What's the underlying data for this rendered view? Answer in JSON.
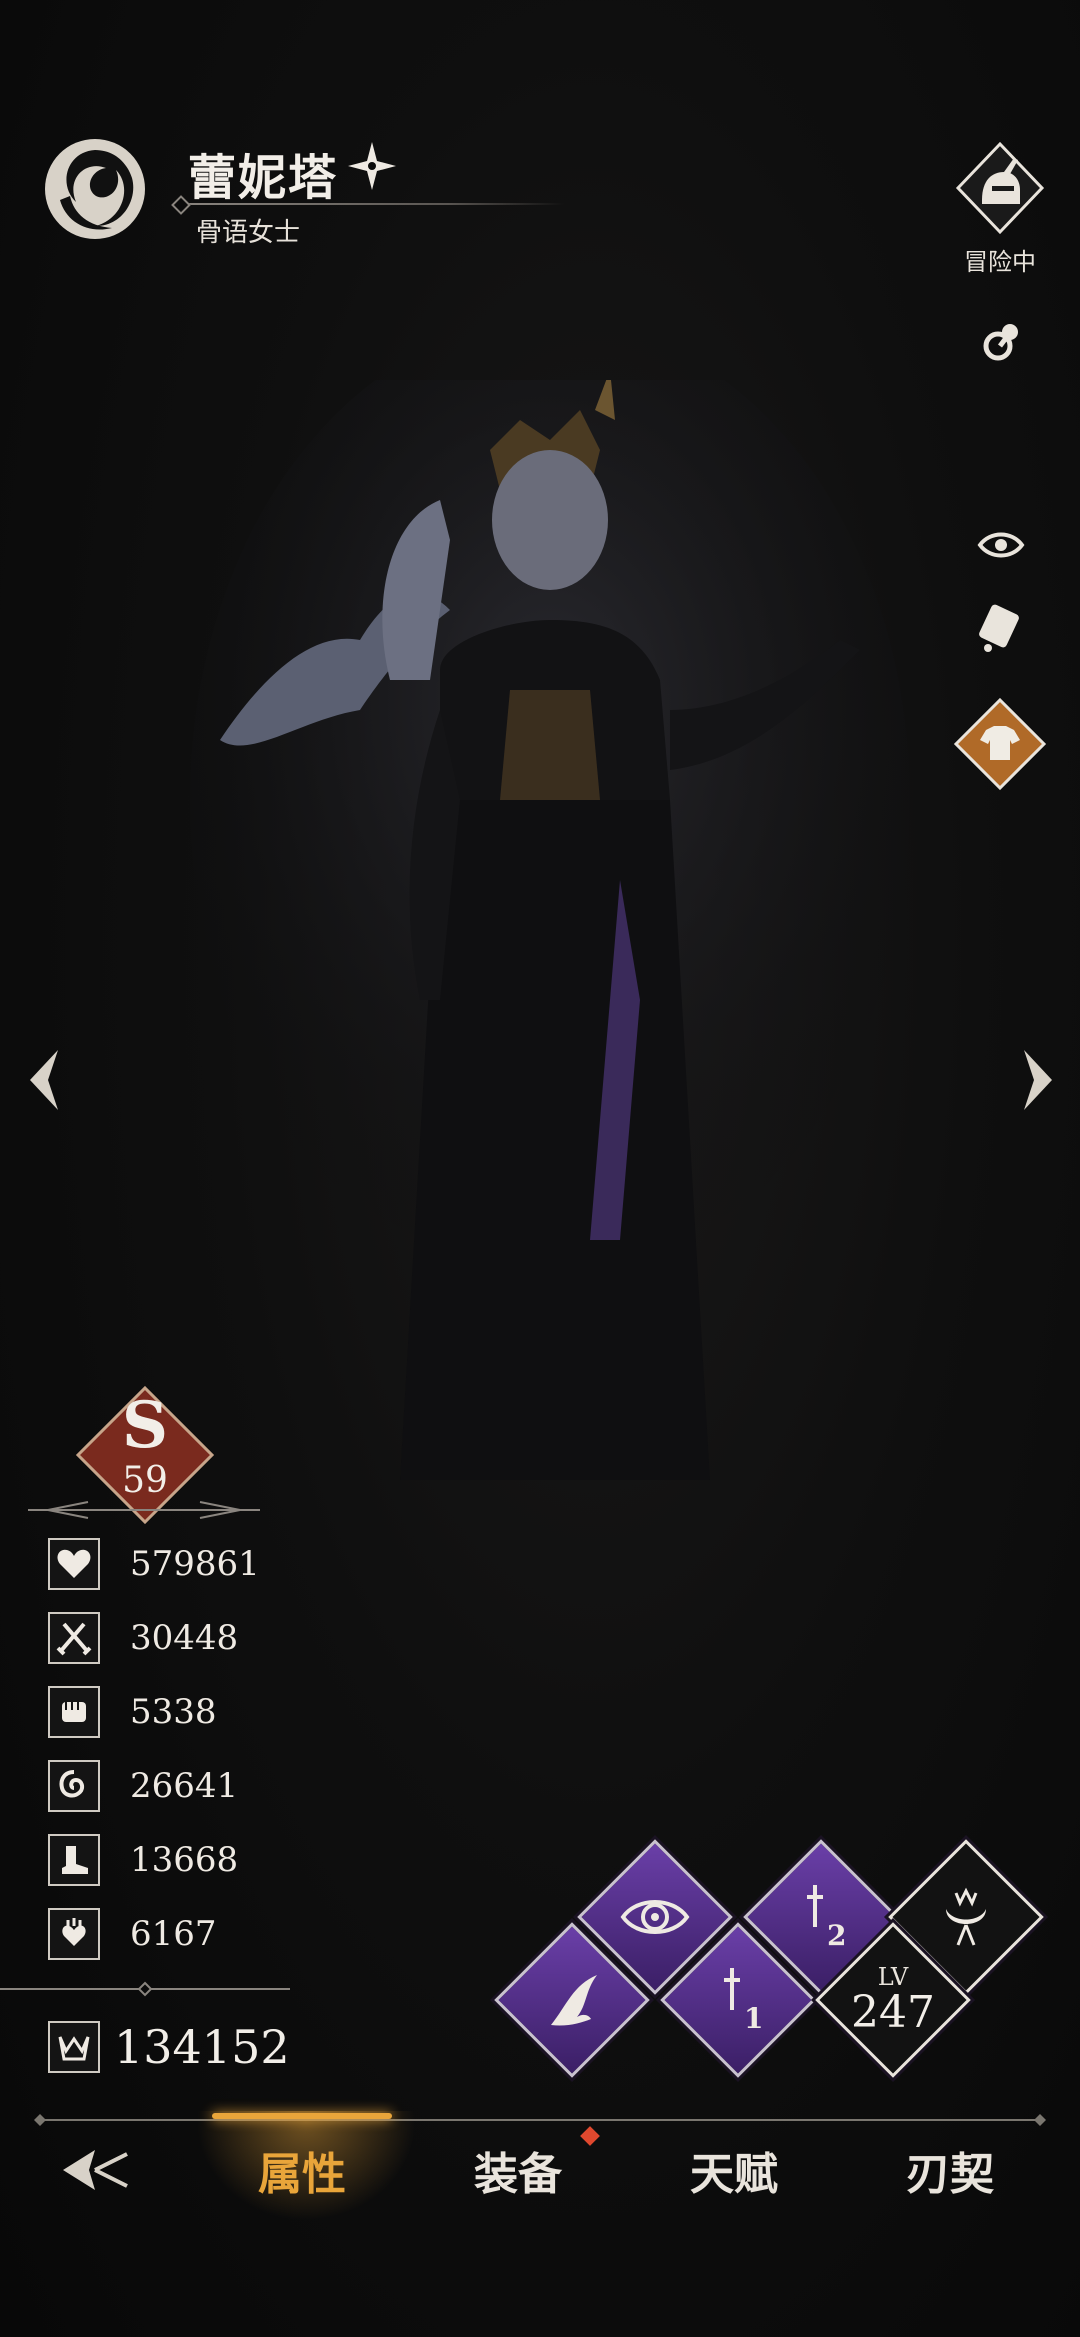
{
  "character": {
    "name": "蕾妮塔",
    "subtitle": "骨语女士"
  },
  "right_panel": {
    "adventure_label": "冒险中"
  },
  "rank": {
    "letter": "S",
    "value": "59"
  },
  "stats": [
    {
      "icon": "heart-icon",
      "value": "579861"
    },
    {
      "icon": "crossed-swords-icon",
      "value": "30448"
    },
    {
      "icon": "fist-icon",
      "value": "5338"
    },
    {
      "icon": "swirl-icon",
      "value": "26641"
    },
    {
      "icon": "boot-icon",
      "value": "13668"
    },
    {
      "icon": "hand-heart-icon",
      "value": "6167"
    }
  ],
  "power": {
    "icon": "crown-emblem-icon",
    "value": "134152"
  },
  "skills": [
    {
      "icon": "wing-icon"
    },
    {
      "icon": "eye-icon"
    },
    {
      "icon": "sword-1-icon",
      "number": "1"
    },
    {
      "icon": "sword-2-icon",
      "number": "2"
    },
    {
      "icon": "crescent-crown-icon"
    }
  ],
  "level": {
    "label": "LV",
    "value": "247"
  },
  "tabs": [
    {
      "label": "属性",
      "active": true
    },
    {
      "label": "装备",
      "badge": true
    },
    {
      "label": "天赋"
    },
    {
      "label": "刃契"
    }
  ],
  "colors": {
    "accent": "#e9a53a",
    "skill_purple": "#6a3fa8",
    "rank_red": "#7a2a1e",
    "badge": "#e0482e"
  }
}
